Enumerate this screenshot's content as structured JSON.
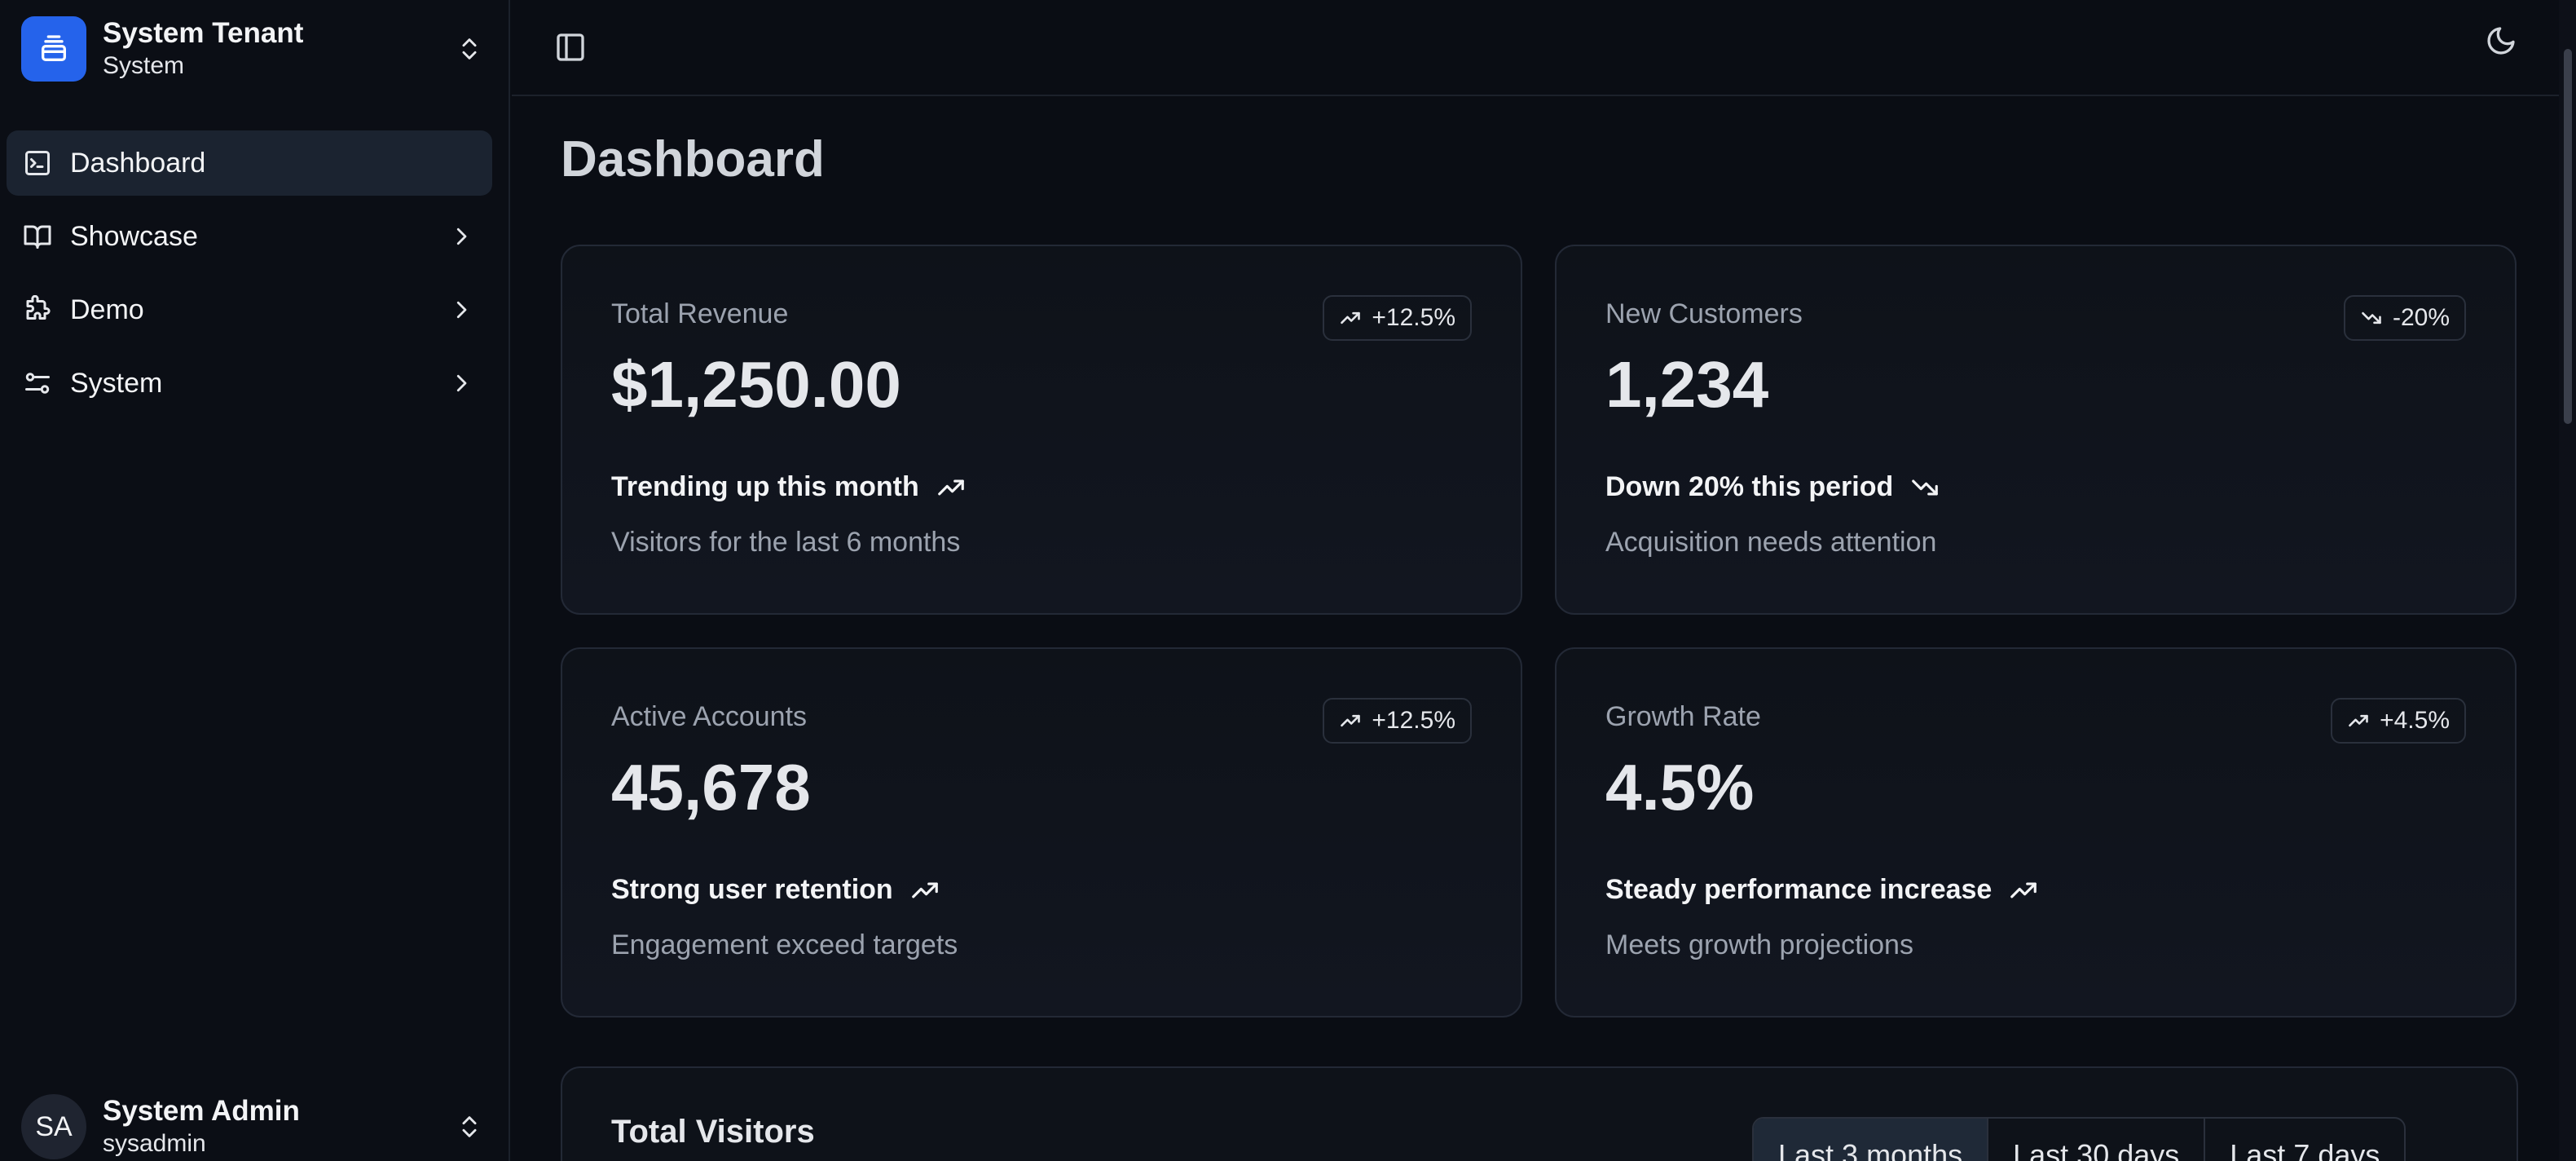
{
  "tenant": {
    "name": "System Tenant",
    "sub": "System"
  },
  "nav": {
    "items": [
      {
        "label": "Dashboard"
      },
      {
        "label": "Showcase"
      },
      {
        "label": "Demo"
      },
      {
        "label": "System"
      }
    ]
  },
  "user": {
    "initials": "SA",
    "name": "System Admin",
    "username": "sysadmin"
  },
  "page": {
    "title": "Dashboard"
  },
  "cards": [
    {
      "label": "Total Revenue",
      "value": "$1,250.00",
      "badge": "+12.5%",
      "trend": "Trending up this month",
      "desc": "Visitors for the last 6 months",
      "direction": "up"
    },
    {
      "label": "New Customers",
      "value": "1,234",
      "badge": "-20%",
      "trend": "Down 20% this period",
      "desc": "Acquisition needs attention",
      "direction": "down"
    },
    {
      "label": "Active Accounts",
      "value": "45,678",
      "badge": "+12.5%",
      "trend": "Strong user retention",
      "desc": "Engagement exceed targets",
      "direction": "up"
    },
    {
      "label": "Growth Rate",
      "value": "4.5%",
      "badge": "+4.5%",
      "trend": "Steady performance increase",
      "desc": "Meets growth projections",
      "direction": "up"
    }
  ],
  "visitors": {
    "title": "Total Visitors",
    "ranges": [
      "Last 3 months",
      "Last 30 days",
      "Last 7 days"
    ],
    "selected": "Last 3 months"
  },
  "colors": {
    "accent": "#2563eb",
    "background": "#0a0d14",
    "card_border": "#232936"
  }
}
